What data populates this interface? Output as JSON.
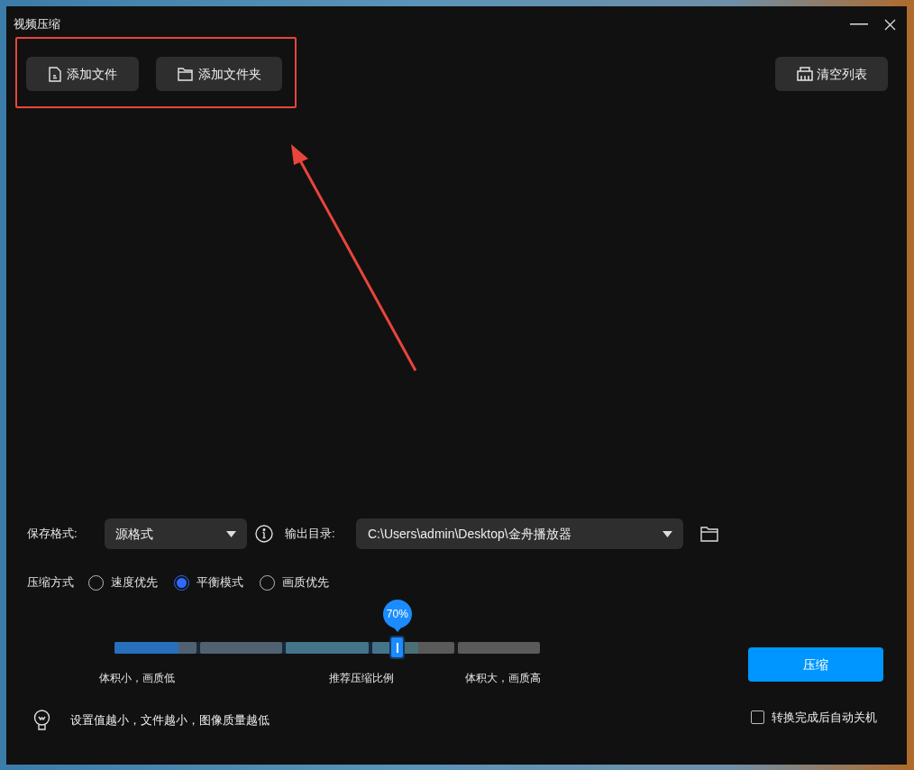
{
  "window": {
    "title": "视频压缩"
  },
  "toolbar": {
    "buttons": [
      {
        "kind": "file",
        "label": "添加文件"
      },
      {
        "kind": "folder",
        "label": "添加文件夹"
      }
    ],
    "clear_button": "清空列表"
  },
  "format": {
    "label": "保存格式:",
    "value": "源格式"
  },
  "output": {
    "label": "输出目录:",
    "value": "C:\\Users\\admin\\Desktop\\金舟播放器"
  },
  "compression_mode": {
    "label": "压缩方式",
    "options": [
      {
        "label": "速度优先",
        "selected": false
      },
      {
        "label": "平衡模式",
        "selected": true
      },
      {
        "label": "画质优先",
        "selected": false
      }
    ]
  },
  "ratio_slider": {
    "level": 0.665,
    "reading": "70%",
    "labels": [
      "体积小，画质低",
      "推荐压缩比例",
      "体积大，画质高"
    ]
  },
  "tip": "设置值越小，文件越小，图像质量越低",
  "compress_button": "压缩",
  "auto_shutdown": {
    "label": "转换完成后自动关机",
    "checked": false
  }
}
